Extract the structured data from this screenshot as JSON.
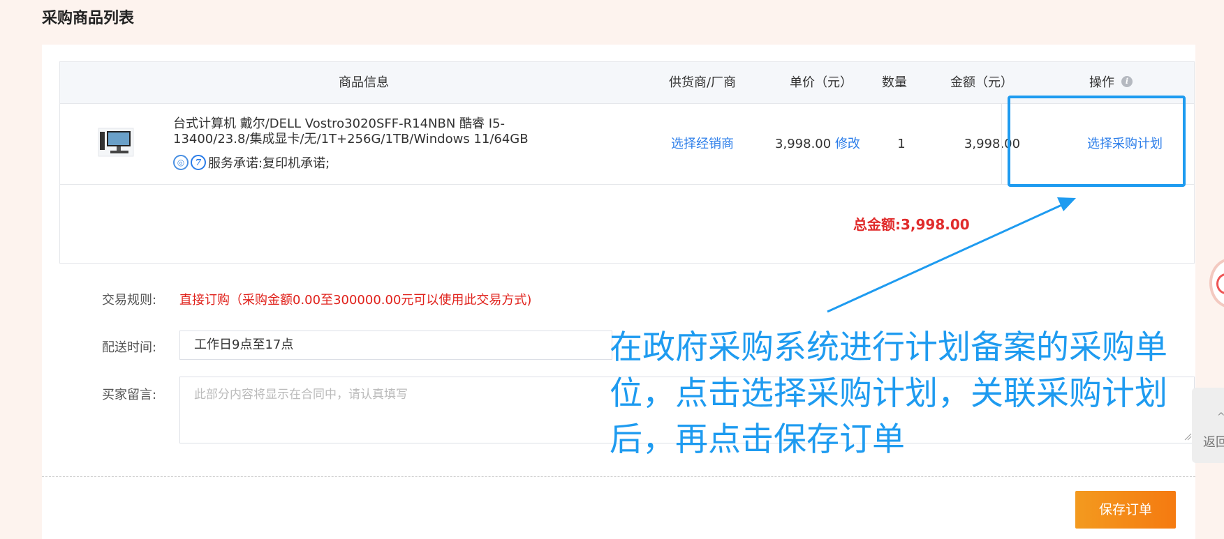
{
  "section_title": "采购商品列表",
  "table": {
    "headers": {
      "product": "商品信息",
      "supplier": "供货商/厂商",
      "price": "单价（元）",
      "quantity": "数量",
      "amount": "金额（元）",
      "action": "操作"
    },
    "row": {
      "product_name": "台式计算机 戴尔/DELL Vostro3020SFF-R14NBN 酷睿 I5-13400/23.8/集成显卡/无/1T+256G/1TB/Windows 11/64GB",
      "service_promise": "服务承诺:复印机承诺;",
      "badge_1": "◎",
      "badge_2": "7",
      "supplier_link": "选择经销商",
      "price": "3,998.00",
      "edit_link": "修改",
      "quantity": "1",
      "amount": "3,998.00",
      "action_link": "选择采购计划"
    },
    "total": "总金额:3,998.00"
  },
  "form": {
    "rule_label": "交易规则:",
    "rule_value": "直接订购（采购金额0.00至300000.00元可以使用此交易方式)",
    "delivery_label": "配送时间:",
    "delivery_value": "工作日9点至17点",
    "message_label": "买家留言:",
    "message_placeholder": "此部分内容将显示在合同中，请认真填写"
  },
  "save_button": "保存订单",
  "annotation": {
    "line1": "在政府采购系统进行计划备案的采购单",
    "line2": "位，点击选择采购计划，关联采购计划",
    "line3": "后，再点击保存订单"
  },
  "side_button": "返回",
  "colors": {
    "link": "#2b7de9",
    "total": "#e02b2b",
    "rule": "#e0211b",
    "save_button": "#f57a10",
    "annotation": "#1e9bf0"
  }
}
